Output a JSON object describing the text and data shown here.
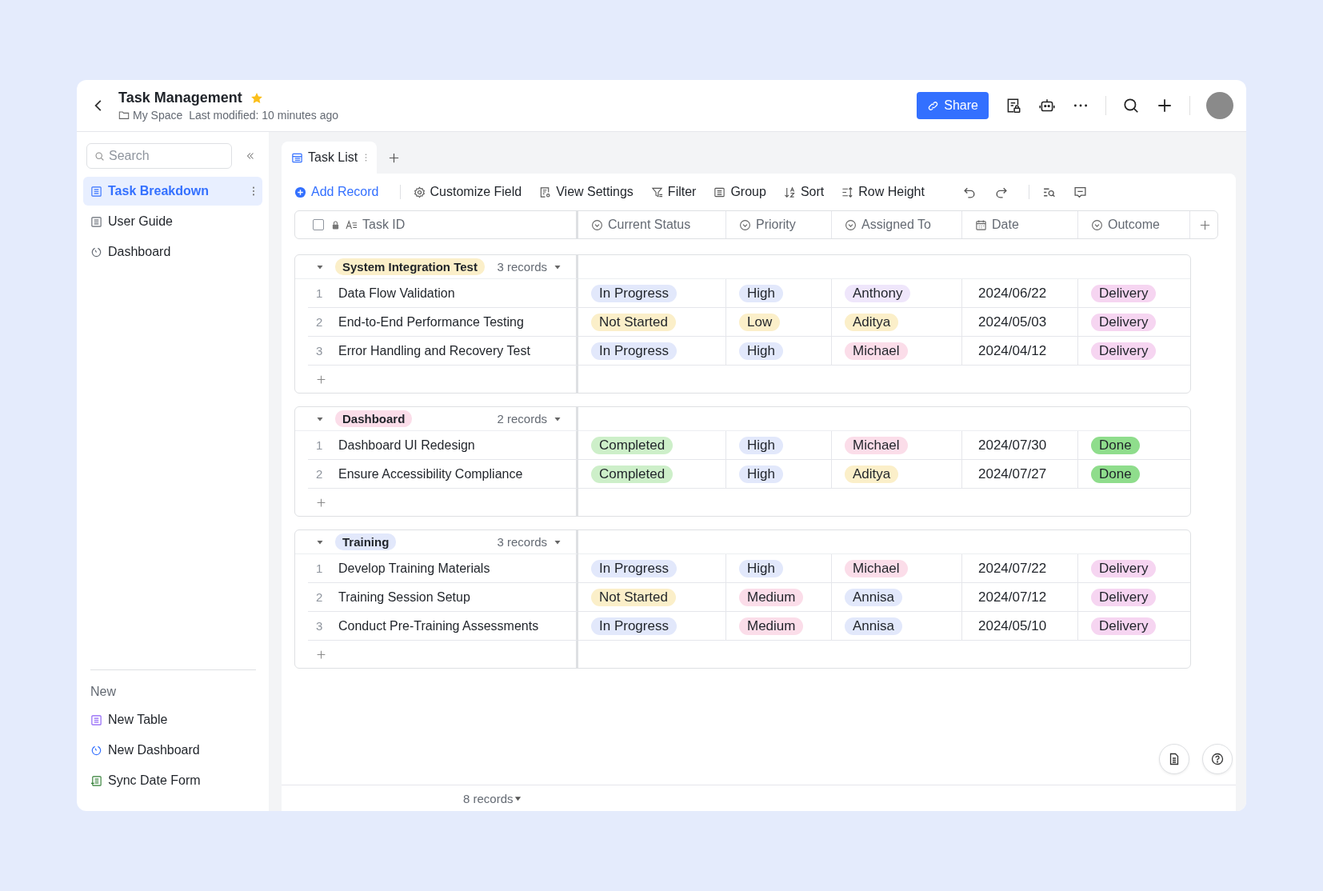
{
  "header": {
    "title": "Task Management",
    "starred": true,
    "breadcrumb": "My Space",
    "modified": "Last modified: 10 minutes ago",
    "share_label": "Share"
  },
  "sidebar": {
    "search_placeholder": "Search",
    "items": [
      {
        "label": "Task Breakdown",
        "kind": "table",
        "selected": true
      },
      {
        "label": "User Guide",
        "kind": "table",
        "selected": false
      },
      {
        "label": "Dashboard",
        "kind": "dashboard",
        "selected": false
      }
    ],
    "new_heading": "New",
    "new_items": [
      {
        "label": "New Table",
        "kind": "table"
      },
      {
        "label": "New Dashboard",
        "kind": "dashboard"
      },
      {
        "label": "Sync Date Form",
        "kind": "form"
      }
    ]
  },
  "tabs": [
    {
      "label": "Task List",
      "selected": true
    }
  ],
  "toolbar": [
    {
      "label": "Add Record",
      "kind": "add"
    },
    {
      "label": "Customize Field",
      "kind": "gear"
    },
    {
      "label": "View Settings",
      "kind": "settings"
    },
    {
      "label": "Filter",
      "kind": "filter"
    },
    {
      "label": "Group",
      "kind": "group"
    },
    {
      "label": "Sort",
      "kind": "sort"
    },
    {
      "label": "Row Height",
      "kind": "height"
    }
  ],
  "columns": [
    {
      "label": "Task ID",
      "kind": "text"
    },
    {
      "label": "Current Status",
      "kind": "select"
    },
    {
      "label": "Priority",
      "kind": "select"
    },
    {
      "label": "Assigned To",
      "kind": "select"
    },
    {
      "label": "Date",
      "kind": "date"
    },
    {
      "label": "Outcome",
      "kind": "select"
    }
  ],
  "groups": [
    {
      "name": "System Integration Test",
      "color": "#fbefc9",
      "count": "3 records",
      "rows": [
        {
          "num": "1",
          "task": "Data Flow Validation",
          "status": {
            "text": "In Progress",
            "color": "#e2e8fb"
          },
          "priority": {
            "text": "High",
            "color": "#e2e8fb"
          },
          "assignee": {
            "text": "Anthony",
            "color": "#efe6fb"
          },
          "date": "2024/06/22",
          "outcome": {
            "text": "Delivery",
            "color": "#f6d5f1"
          }
        },
        {
          "num": "2",
          "task": "End-to-End Performance Testing",
          "status": {
            "text": "Not Started",
            "color": "#fbefc9"
          },
          "priority": {
            "text": "Low",
            "color": "#fbefc9"
          },
          "assignee": {
            "text": "Aditya",
            "color": "#fbefc9"
          },
          "date": "2024/05/03",
          "outcome": {
            "text": "Delivery",
            "color": "#f6d5f1"
          }
        },
        {
          "num": "3",
          "task": "Error Handling and Recovery Test",
          "status": {
            "text": "In Progress",
            "color": "#e2e8fb"
          },
          "priority": {
            "text": "High",
            "color": "#e2e8fb"
          },
          "assignee": {
            "text": "Michael",
            "color": "#fbdde9"
          },
          "date": "2024/04/12",
          "outcome": {
            "text": "Delivery",
            "color": "#f6d5f1"
          }
        }
      ]
    },
    {
      "name": "Dashboard",
      "color": "#fbdde9",
      "count": "2 records",
      "rows": [
        {
          "num": "1",
          "task": "Dashboard UI Redesign",
          "status": {
            "text": "Completed",
            "color": "#cdefc9"
          },
          "priority": {
            "text": "High",
            "color": "#e2e8fb"
          },
          "assignee": {
            "text": "Michael",
            "color": "#fbdde9"
          },
          "date": "2024/07/30",
          "outcome": {
            "text": "Done",
            "color": "#8fdd8c"
          }
        },
        {
          "num": "2",
          "task": "Ensure Accessibility Compliance",
          "status": {
            "text": "Completed",
            "color": "#cdefc9"
          },
          "priority": {
            "text": "High",
            "color": "#e2e8fb"
          },
          "assignee": {
            "text": "Aditya",
            "color": "#fbefc9"
          },
          "date": "2024/07/27",
          "outcome": {
            "text": "Done",
            "color": "#8fdd8c"
          }
        }
      ]
    },
    {
      "name": "Training",
      "color": "#e2e8fb",
      "count": "3 records",
      "rows": [
        {
          "num": "1",
          "task": "Develop Training Materials",
          "status": {
            "text": "In Progress",
            "color": "#e2e8fb"
          },
          "priority": {
            "text": "High",
            "color": "#e2e8fb"
          },
          "assignee": {
            "text": "Michael",
            "color": "#fbdde9"
          },
          "date": "2024/07/22",
          "outcome": {
            "text": "Delivery",
            "color": "#f6d5f1"
          }
        },
        {
          "num": "2",
          "task": "Training Session Setup",
          "status": {
            "text": "Not Started",
            "color": "#fbefc9"
          },
          "priority": {
            "text": "Medium",
            "color": "#fbdde9"
          },
          "assignee": {
            "text": "Annisa",
            "color": "#e2e8fb"
          },
          "date": "2024/07/12",
          "outcome": {
            "text": "Delivery",
            "color": "#f6d5f1"
          }
        },
        {
          "num": "3",
          "task": "Conduct Pre-Training Assessments",
          "status": {
            "text": "In Progress",
            "color": "#e2e8fb"
          },
          "priority": {
            "text": "Medium",
            "color": "#fbdde9"
          },
          "assignee": {
            "text": "Annisa",
            "color": "#e2e8fb"
          },
          "date": "2024/05/10",
          "outcome": {
            "text": "Delivery",
            "color": "#f6d5f1"
          }
        }
      ]
    }
  ],
  "select_all": {
    "checked": false
  },
  "footer": {
    "count": "8 records"
  }
}
